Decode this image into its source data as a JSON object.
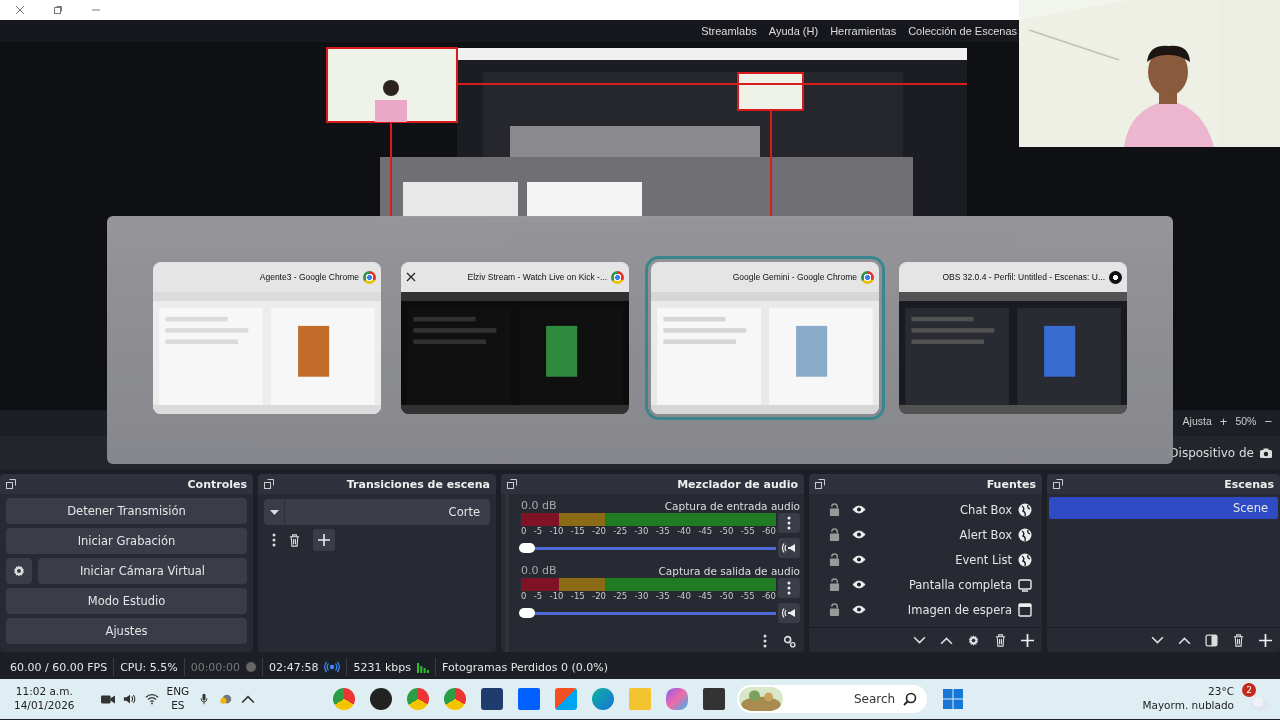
{
  "menu": [
    {
      "label": "Streamlabs"
    },
    {
      "label": "Ayuda (H)"
    },
    {
      "label": "Herramientas"
    },
    {
      "label": "Colección de Escenas"
    }
  ],
  "preview_bar": {
    "fit_label": "Ajusta",
    "zoom_in": "+",
    "zoom": "50%",
    "zoom_out": "−"
  },
  "source_toolbar": {
    "label": "Dispositivo de"
  },
  "task_switcher": {
    "windows": [
      {
        "title": "Agente3 - Google Chrome",
        "kind": "chrome",
        "selected": false,
        "close_shown": false
      },
      {
        "title": "Elziv Stream - Watch Live on Kick -...",
        "kind": "chrome",
        "selected": false,
        "close_shown": true
      },
      {
        "title": "Google Gemini - Google Chrome",
        "kind": "chrome",
        "selected": true,
        "close_shown": false
      },
      {
        "title": "OBS 32.0.4 - Perfil: Untitled - Escenas: U...",
        "kind": "obs",
        "selected": false,
        "close_shown": false
      }
    ]
  },
  "controls": {
    "title": "Controles",
    "buttons": [
      {
        "label": "Detener Transmisión",
        "has_settings": false
      },
      {
        "label": "Iniciar Grabación",
        "has_settings": false
      },
      {
        "label": "Iniciar Cámara Virtual",
        "has_settings": true
      },
      {
        "label": "Modo Estudio",
        "has_settings": false
      },
      {
        "label": "Ajustes",
        "has_settings": false
      }
    ]
  },
  "transitions": {
    "title": "Transiciones de escena",
    "value": "Corte"
  },
  "mixer": {
    "title": "Mezclador de audio",
    "channels": [
      {
        "name": "Captura de entrada audio",
        "reading": "0.0 dB",
        "level": 1,
        "scale": [
          "0",
          "-5",
          "-10",
          "-15",
          "-20",
          "-25",
          "-30",
          "-35",
          "-40",
          "-45",
          "-50",
          "-55",
          "-60"
        ]
      },
      {
        "name": "Captura de salida de audio",
        "reading": "0.0 dB",
        "level": 1,
        "scale": [
          "0",
          "-5",
          "-10",
          "-15",
          "-20",
          "-25",
          "-30",
          "-35",
          "-40",
          "-45",
          "-50",
          "-55",
          "-60"
        ]
      }
    ]
  },
  "sources": {
    "title": "Fuentes",
    "items": [
      {
        "name": "Chat Box",
        "kind": "browser",
        "visible": true,
        "locked": false
      },
      {
        "name": "Alert Box",
        "kind": "browser",
        "visible": true,
        "locked": false
      },
      {
        "name": "Event List",
        "kind": "browser",
        "visible": true,
        "locked": false
      },
      {
        "name": "Pantalla completa",
        "kind": "display",
        "visible": true,
        "locked": false
      },
      {
        "name": "Imagen de espera",
        "visible": true,
        "locked": false
      }
    ]
  },
  "scenes": {
    "title": "Escenas",
    "items": [
      {
        "name": "Scene",
        "selected": true
      }
    ]
  },
  "status_bar": {
    "fps": "60.00 / 60.00 FPS",
    "cpu": "CPU: 5.5%",
    "recording": false,
    "record_time": "00:00:00",
    "streaming": true,
    "stream_time": "02:47:58",
    "bitrate": "5231 kbps",
    "dropped": "Fotogramas Perdidos 0 (0.0%)"
  },
  "taskbar": {
    "clock": "11:02 a.m.",
    "date": "14/01/2026",
    "language": "ENG",
    "layout": "ES",
    "search": {
      "placeholder": "Search"
    },
    "weather": {
      "temp": "23°C",
      "desc": "Mayorm. nublado",
      "badge": "2"
    }
  }
}
